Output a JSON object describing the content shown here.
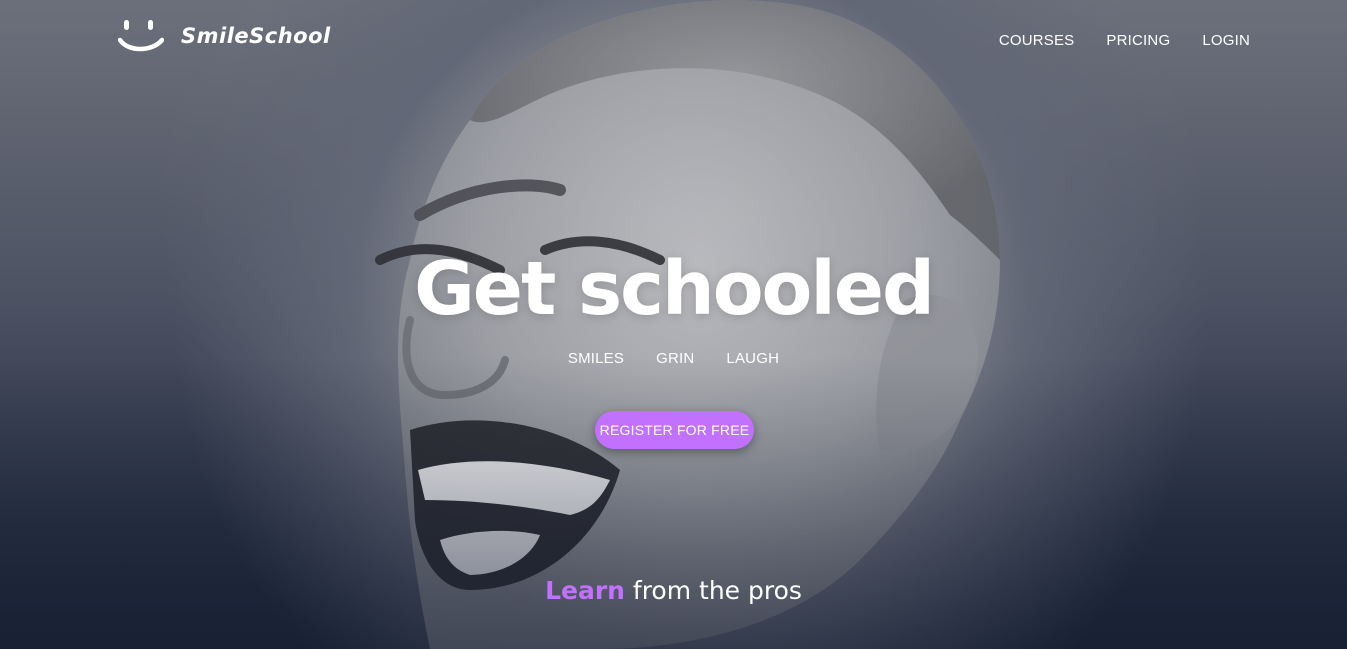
{
  "brand": {
    "name": "SmileSchool",
    "logo_icon": "smile-icon"
  },
  "nav": {
    "items": [
      "COURSES",
      "PRICING",
      "LOGIN"
    ]
  },
  "hero": {
    "headline": "Get schooled",
    "tags": [
      "SMILES",
      "GRIN",
      "LAUGH"
    ],
    "cta_label": "REGISTER FOR FREE",
    "subhead_accent": "Learn",
    "subhead_rest": " from the pros",
    "background_image": "black-and-white portrait photo of a laughing woman with short hair"
  },
  "colors": {
    "accent": "#c271ff",
    "overlay": "#1c2539",
    "text": "#ffffff"
  }
}
